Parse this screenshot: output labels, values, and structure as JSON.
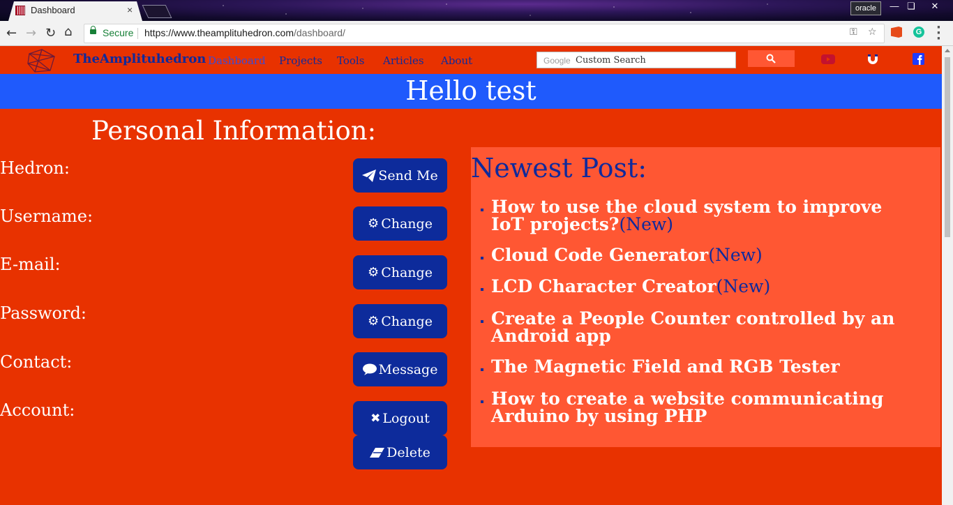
{
  "browser": {
    "tab_title": "Dashboard",
    "tab_close": "×",
    "profile": "oracle",
    "secure_label": "Secure",
    "url_host": "https://www.theamplituhedron.com",
    "url_path": "/dashboard/"
  },
  "site": {
    "brand": "TheAmplituhedron",
    "nav": [
      {
        "label": "Dashboard",
        "active": true
      },
      {
        "label": "Projects"
      },
      {
        "label": "Tools"
      },
      {
        "label": "Articles"
      },
      {
        "label": "About"
      }
    ],
    "search": {
      "google": "Google",
      "placeholder": "Custom Search"
    },
    "social_icons": [
      "youtube-icon",
      "magnet-icon",
      "facebook-icon"
    ],
    "colors": {
      "page": "#e83200",
      "band": "#1f5afc",
      "accent": "#ff5733",
      "button": "#0d2b9b",
      "link": "#0f2a9c"
    }
  },
  "greeting": "Hello test",
  "personal": {
    "title": "Personal Information:",
    "fields": [
      {
        "label": "Hedron:",
        "button": "Send Me",
        "icon": "paper-plane-icon"
      },
      {
        "label": "Username:",
        "button": "Change",
        "icon": "gear-icon"
      },
      {
        "label": "E-mail:",
        "button": "Change",
        "icon": "gear-icon"
      },
      {
        "label": "Password:",
        "button": "Change",
        "icon": "gear-icon"
      },
      {
        "label": "Contact:",
        "button": "Message",
        "icon": "speech-bubble-icon"
      },
      {
        "label": "Account:",
        "button": "Logout",
        "icon": "close-icon"
      }
    ],
    "delete_button": "Delete"
  },
  "newest": {
    "title": "Newest Post:",
    "new_tag": "(New)",
    "posts": [
      {
        "title": "How to use the cloud system to improve IoT projects?",
        "is_new": true
      },
      {
        "title": "Cloud Code Generator",
        "is_new": true
      },
      {
        "title": "LCD Character Creator",
        "is_new": true
      },
      {
        "title": "Create a People Counter controlled by an Android app",
        "is_new": false
      },
      {
        "title": "The Magnetic Field and RGB Tester",
        "is_new": false
      },
      {
        "title": "How to create a website communicating Arduino by using PHP",
        "is_new": false
      }
    ]
  }
}
